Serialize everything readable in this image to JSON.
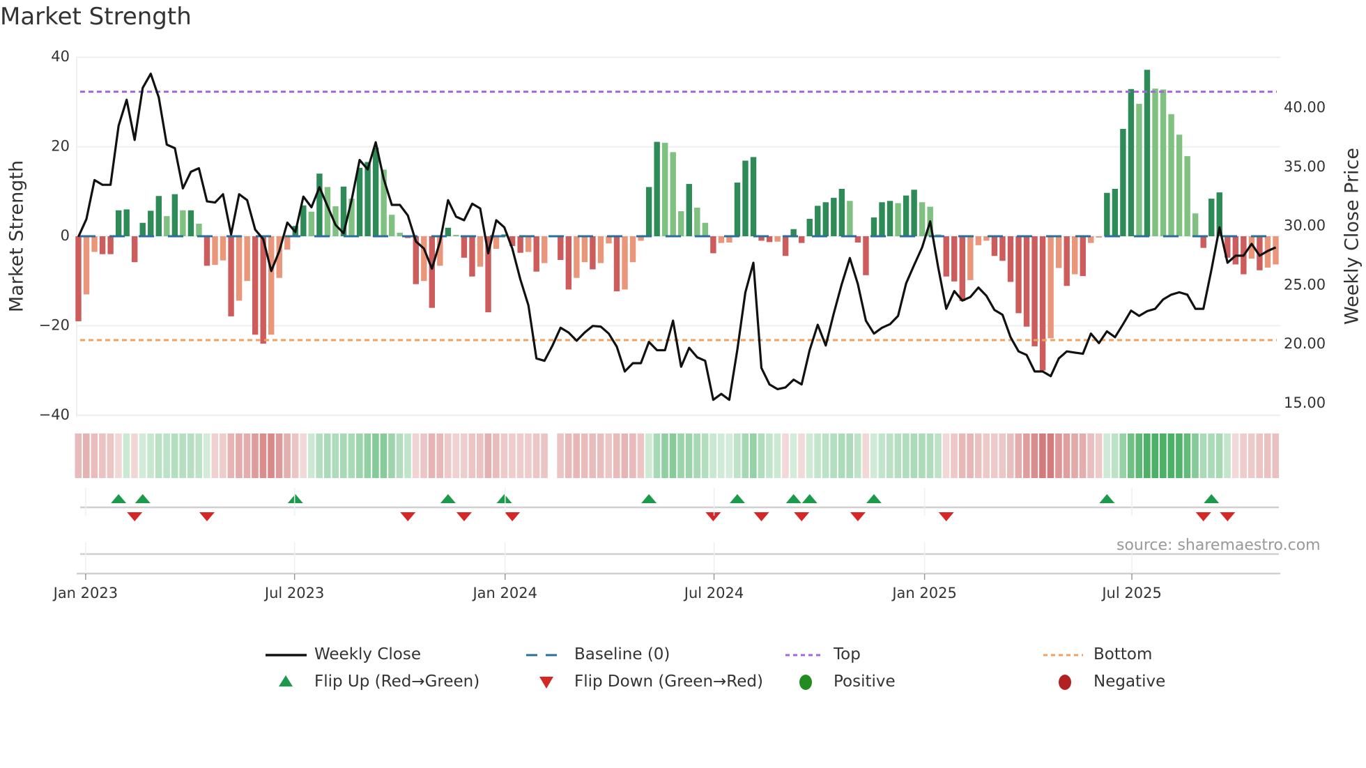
{
  "title": "Market Strength",
  "source": "source: sharemaestro.com",
  "legend": {
    "weekly_close": "Weekly Close",
    "baseline": "Baseline (0)",
    "top": "Top",
    "bottom": "Bottom",
    "flip_up": "Flip Up (Red→Green)",
    "flip_down": "Flip Down (Green→Red)",
    "positive": "Positive",
    "negative": "Negative"
  },
  "colors": {
    "bar_up_strong": "#2e8b57",
    "bar_up_weak": "#80c080",
    "bar_down_strong": "#cd5c5c",
    "bar_down_weak": "#e9967a",
    "close_line": "#111111",
    "baseline": "#2a6f9b",
    "top": "#a466e0",
    "bottom": "#f0a060",
    "flip_up": "#1a9a4a",
    "flip_down": "#d62728",
    "positive": "#228b22",
    "negative": "#b22222"
  },
  "chart_data": {
    "type": "bar+line",
    "title": "Market Strength",
    "ylabel": "Market Strength",
    "y2label": "Weekly Close Price",
    "ylim": [
      -40,
      40
    ],
    "y2lim": [
      12.8,
      43.8
    ],
    "yticks": [
      "40",
      "20",
      "0",
      "−20",
      "−40"
    ],
    "ytick_values": [
      40,
      20,
      0,
      -20,
      -40
    ],
    "y2ticks": [
      "15.00",
      "20.00",
      "25.00",
      "30.00",
      "35.00",
      "40.00"
    ],
    "y2tick_values": [
      15,
      20,
      25,
      30,
      35,
      40
    ],
    "top_level": 32.3,
    "bottom_level": -23.2,
    "baseline_level": 0,
    "frequency": "weekly",
    "x_ticks": [
      {
        "label": "Jan 2023",
        "week": 0.9
      },
      {
        "label": "Jul 2023",
        "week": 26.9
      },
      {
        "label": "Jan 2024",
        "week": 53.1
      },
      {
        "label": "Jul 2024",
        "week": 79.1
      },
      {
        "label": "Jan 2025",
        "week": 105.3
      },
      {
        "label": "Jul 2025",
        "week": 131.1
      }
    ],
    "strength": [
      -19,
      -13,
      -3.5,
      -4,
      -4,
      5.8,
      6,
      -5.8,
      3,
      5.7,
      9,
      4.5,
      9.4,
      5.8,
      5.8,
      2.8,
      -6.6,
      -6.4,
      -5.4,
      -17.9,
      -14.4,
      -10,
      -22,
      -24,
      -22,
      -9.3,
      -3,
      2.3,
      6.9,
      5.5,
      14,
      11,
      6.7,
      11.1,
      8.4,
      15.3,
      16.6,
      19.8,
      14.9,
      4.8,
      0.8,
      -0.4,
      -10.7,
      -10,
      -16,
      -6.6,
      1.9,
      0.3,
      -4.8,
      -9,
      -6.8,
      -17,
      -2.8,
      0.4,
      -2.2,
      -3.7,
      -3.5,
      -7.9,
      -6,
      null,
      -5.3,
      -11.9,
      -9.3,
      -5.8,
      -7.4,
      -6,
      -1.6,
      -12.3,
      -11.9,
      -5.8,
      -1,
      11,
      21.1,
      20.9,
      18.8,
      5.6,
      11.7,
      6.4,
      3.0,
      -3.8,
      -1.5,
      -1.4,
      12,
      16.9,
      17.7,
      -1.0,
      -1.3,
      -1.2,
      -4.4,
      1.6,
      -1.5,
      3.9,
      6.8,
      7.6,
      8.6,
      10.6,
      7.9,
      -1.4,
      -8.7,
      4.2,
      7.6,
      7.9,
      7.4,
      9.1,
      10.4,
      7.6,
      6.6,
      0.4,
      -9.0,
      -10.1,
      -14.5,
      -9.8,
      -2.0,
      -1.0,
      -4.4,
      -5.5,
      -10.2,
      -17.2,
      -20.2,
      -24.6,
      -30,
      -22.8,
      -7.1,
      -11.1,
      -8.5,
      -8.9,
      -1.5,
      -0.3,
      9.7,
      10.6,
      24,
      32.9,
      29.6,
      37.2,
      33,
      32.8,
      27.3,
      22.7,
      17.9,
      5.1,
      -2.6,
      8.4,
      9.8,
      -4.8,
      -6.3,
      -8.5,
      -5.0,
      -7.6,
      -7.0,
      -6.3
    ],
    "weekly_close": [
      29.1,
      30.6,
      33.9,
      33.5,
      33.5,
      38.5,
      40.7,
      37.3,
      41.7,
      42.9,
      40.9,
      36.9,
      36.6,
      33.2,
      34.6,
      34.9,
      32.1,
      32.0,
      32.7,
      29.3,
      32.7,
      32.2,
      29.7,
      28.9,
      26.2,
      27.9,
      30.3,
      29.5,
      32.5,
      31.6,
      33.3,
      31.7,
      30.1,
      29.4,
      32.2,
      35.6,
      34.8,
      37.1,
      34.0,
      31.8,
      31.8,
      30.9,
      28.7,
      28.1,
      26.4,
      28.7,
      32.2,
      30.8,
      30.5,
      31.9,
      31.5,
      27.7,
      30.5,
      29.9,
      28.1,
      25.5,
      23.3,
      18.8,
      18.6,
      19.9,
      21.4,
      21.0,
      20.3,
      21.0,
      21.55,
      21.5,
      20.9,
      19.8,
      17.7,
      18.4,
      18.4,
      20.2,
      19.5,
      19.5,
      22.0,
      18.1,
      19.7,
      18.9,
      18.6,
      15.3,
      15.8,
      15.3,
      19.55,
      24.4,
      26.9,
      18.0,
      16.6,
      16.2,
      16.35,
      17.0,
      16.6,
      19.5,
      21.65,
      19.9,
      22.6,
      25.1,
      27.3,
      25.1,
      22.0,
      20.9,
      21.4,
      21.7,
      22.4,
      25.15,
      26.7,
      28.2,
      30.4,
      26.5,
      23.0,
      24.5,
      23.7,
      24.0,
      24.8,
      24.1,
      22.9,
      22.5,
      20.6,
      19.4,
      19.1,
      17.7,
      17.7,
      17.3,
      18.8,
      19.4,
      19.3,
      19.2,
      20.9,
      20.1,
      21.1,
      20.6,
      21.7,
      22.85,
      22.4,
      22.8,
      23.0,
      23.8,
      24.2,
      24.4,
      24.2,
      23.0,
      23.0,
      26.3,
      29.9,
      26.9,
      27.5,
      27.5,
      28.5,
      27.5,
      27.9,
      28.2
    ],
    "flip_up_weeks": [
      5,
      8,
      27,
      46,
      53,
      71,
      82,
      89,
      91,
      99,
      128,
      141
    ],
    "flip_down_weeks": [
      7,
      16,
      41,
      48,
      54,
      79,
      85,
      90,
      97,
      108,
      140,
      143
    ]
  }
}
